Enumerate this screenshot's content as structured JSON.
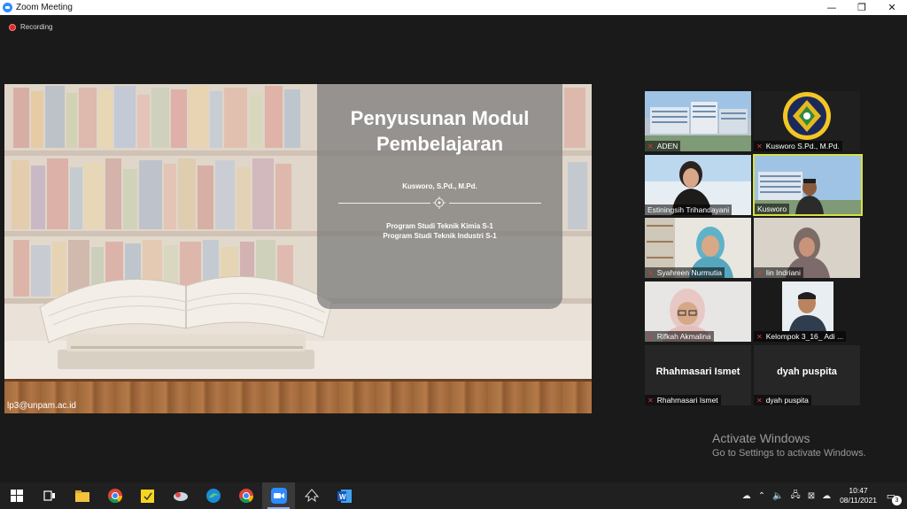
{
  "window": {
    "title": "Zoom Meeting",
    "minimize": "—",
    "maximize": "❐",
    "close": "✕"
  },
  "recording": {
    "label": "Recording"
  },
  "slide": {
    "title_line1": "Penyusunan Modul",
    "title_line2": "Pembelajaran",
    "author": "Kusworo, S.Pd., M.Pd.",
    "program1": "Program Studi Teknik Kimia S-1",
    "program2": "Program Studi Teknik Industri S-1",
    "email": "lp3@unpam.ac.id"
  },
  "participants": [
    {
      "name": "ADEN",
      "muted": true,
      "video": "campus-photo"
    },
    {
      "name": "Kusworo S.Pd., M.Pd.",
      "muted": true,
      "video": "logo"
    },
    {
      "name": "Estiningsih Trihandayani",
      "muted": false,
      "video": "camera"
    },
    {
      "name": "Kusworo",
      "muted": false,
      "video": "campus-photo",
      "active_speaker": true
    },
    {
      "name": "Syahreen Nurmutia",
      "muted": true,
      "video": "camera"
    },
    {
      "name": "Iin Indriani",
      "muted": true,
      "video": "camera"
    },
    {
      "name": "Rifkah Akmalina",
      "muted": true,
      "video": "camera"
    },
    {
      "name": "Kelompok 3_16_ Adi ...",
      "muted": true,
      "video": "camera"
    },
    {
      "name": "Rhahmasari Ismet",
      "muted": true,
      "video": "off",
      "big_name": "Rhahmasari Ismet"
    },
    {
      "name": "dyah puspita",
      "muted": true,
      "video": "off",
      "big_name": "dyah puspita"
    }
  ],
  "activation": {
    "line1": "Activate Windows",
    "line2": "Go to Settings to activate Windows."
  },
  "taskbar": {
    "apps": [
      "windows-start",
      "task-view",
      "file-explorer",
      "chrome",
      "sticky-notes",
      "network-app",
      "edge",
      "chrome-profile",
      "zoom",
      "inkscape",
      "word"
    ],
    "time": "10:47",
    "date": "08/11/2021",
    "notifications": "3"
  },
  "colors": {
    "accent": "#2d8cff",
    "active_speaker": "#d8e040",
    "muted": "#e03838"
  }
}
